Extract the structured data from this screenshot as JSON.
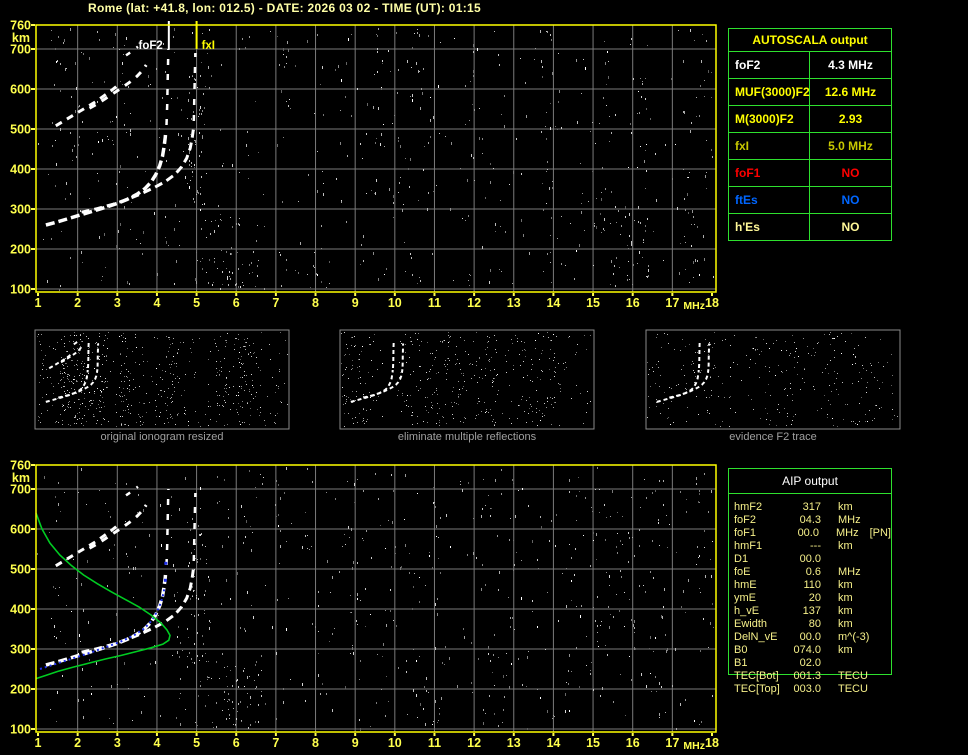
{
  "header": {
    "station": "Rome",
    "lat": "+41.8",
    "lon": "012.5",
    "date": "2026 03 02",
    "time_ut": "01:15",
    "full": "Rome (lat: +41.8, lon: 012.5) - DATE: 2026 03 02 - TIME (UT): 01:15"
  },
  "colors": {
    "title": "#ffffa6",
    "axis": "#ffff4d",
    "grid": "#7a7a7a",
    "plot_border": "#ffff00",
    "table_border": "#2ee02e",
    "aip_text": "#f6f08a",
    "trace": "#ffffff",
    "profile": "#00cc22",
    "restored": "#2233ee",
    "caption": "#a0a0a0"
  },
  "autoscala_table": {
    "header": "AUTOSCALA output",
    "rows": [
      {
        "param": "foF2",
        "value": "4.3 MHz",
        "color": "#ffffff"
      },
      {
        "param": "MUF(3000)F2",
        "value": "12.6 MHz",
        "color": "#ffff00"
      },
      {
        "param": "M(3000)F2",
        "value": "2.93",
        "color": "#ffff00"
      },
      {
        "param": "fxI",
        "value": "5.0 MHz",
        "color": "#c8c800"
      },
      {
        "param": "foF1",
        "value": "NO",
        "color": "#ff0000"
      },
      {
        "param": "ftEs",
        "value": "NO",
        "color": "#0066ff"
      },
      {
        "param": "h'Es",
        "value": "NO",
        "color": "#fff898"
      }
    ]
  },
  "aip_table": {
    "header": "AIP output",
    "rows": [
      {
        "param": "hmF2",
        "value": "317",
        "unit": "km",
        "note": ""
      },
      {
        "param": "foF2",
        "value": "04.3",
        "unit": "MHz",
        "note": ""
      },
      {
        "param": "foF1",
        "value": "00.0",
        "unit": "MHz",
        "note": "[PN]"
      },
      {
        "param": "hmF1",
        "value": "---",
        "unit": "km",
        "note": ""
      },
      {
        "param": "D1",
        "value": "00.0",
        "unit": "",
        "note": ""
      },
      {
        "param": "foE",
        "value": "0.6",
        "unit": "MHz",
        "note": ""
      },
      {
        "param": "hmE",
        "value": "110",
        "unit": "km",
        "note": ""
      },
      {
        "param": "ymE",
        "value": "20",
        "unit": "km",
        "note": ""
      },
      {
        "param": "h_vE",
        "value": "137",
        "unit": "km",
        "note": ""
      },
      {
        "param": "Ewidth",
        "value": "80",
        "unit": "km",
        "note": ""
      },
      {
        "param": "DelN_vE",
        "value": "00.0",
        "unit": "m^(-3)",
        "note": ""
      },
      {
        "param": "B0",
        "value": "074.0",
        "unit": "km",
        "note": ""
      },
      {
        "param": "B1",
        "value": "02.0",
        "unit": "",
        "note": ""
      },
      {
        "param": "TEC[Bot]",
        "value": "001.3",
        "unit": "TECU",
        "note": ""
      },
      {
        "param": "TEC[Top]",
        "value": "003.0",
        "unit": "TECU",
        "note": ""
      }
    ]
  },
  "thumbnails": [
    {
      "caption": "original ionogram resized"
    },
    {
      "caption": "eliminate multiple reflections"
    },
    {
      "caption": "evidence F2 trace"
    }
  ],
  "chart_data": {
    "type": "scatter",
    "title": "Rome ionogram 2026-03-02 01:15 UT, autoscaled by AUTOSCALA",
    "xlabel": "MHz",
    "ylabel": "km",
    "xlim": [
      1,
      18
    ],
    "ylim": [
      100,
      760
    ],
    "x_ticks": [
      1,
      2,
      3,
      4,
      5,
      6,
      7,
      8,
      9,
      10,
      11,
      12,
      13,
      14,
      15,
      16,
      17,
      18
    ],
    "y_ticks": [
      760,
      700,
      600,
      500,
      400,
      300,
      200,
      100
    ],
    "grid": true,
    "legend": "none",
    "echo_traces": [
      {
        "name": "F2 O-mode trace",
        "color": "#ffffff",
        "width": 3.5,
        "dash": "9 4",
        "multiple_reflection": false,
        "points": [
          [
            1.2,
            260
          ],
          [
            1.5,
            268
          ],
          [
            1.8,
            277
          ],
          [
            2.1,
            286
          ],
          [
            2.4,
            295
          ],
          [
            2.7,
            304
          ],
          [
            3.0,
            314
          ],
          [
            3.25,
            324
          ],
          [
            3.5,
            337
          ],
          [
            3.7,
            351
          ],
          [
            3.85,
            367
          ],
          [
            3.97,
            386
          ],
          [
            4.07,
            408
          ],
          [
            4.14,
            432
          ],
          [
            4.18,
            456
          ],
          [
            4.21,
            480
          ],
          [
            4.22,
            495
          ]
        ]
      },
      {
        "name": "F2 O-mode asymptote",
        "color": "#ffffff",
        "width": 2.5,
        "dash": "6 9",
        "multiple_reflection": false,
        "points": [
          [
            4.24,
            510
          ],
          [
            4.26,
            560
          ],
          [
            4.27,
            610
          ],
          [
            4.28,
            660
          ],
          [
            4.29,
            700
          ]
        ]
      },
      {
        "name": "F2 X-mode trace",
        "color": "#ffffff",
        "width": 3,
        "dash": "8 5",
        "multiple_reflection": false,
        "points": [
          [
            2.1,
            292
          ],
          [
            2.5,
            301
          ],
          [
            2.9,
            312
          ],
          [
            3.25,
            324
          ],
          [
            3.6,
            338
          ],
          [
            3.9,
            352
          ],
          [
            4.2,
            368
          ],
          [
            4.45,
            386
          ],
          [
            4.62,
            405
          ],
          [
            4.75,
            427
          ],
          [
            4.84,
            452
          ],
          [
            4.89,
            478
          ],
          [
            4.92,
            500
          ]
        ]
      },
      {
        "name": "F2 X-mode asymptote",
        "color": "#ffffff",
        "width": 2.5,
        "dash": "6 10",
        "multiple_reflection": false,
        "points": [
          [
            4.93,
            520
          ],
          [
            4.94,
            565
          ],
          [
            4.95,
            610
          ],
          [
            4.96,
            655
          ],
          [
            4.97,
            690
          ]
        ]
      },
      {
        "name": "second hop O",
        "color": "#ffffff",
        "width": 3,
        "dash": "7 6",
        "multiple_reflection": true,
        "points": [
          [
            1.45,
            508
          ],
          [
            1.65,
            520
          ],
          [
            1.85,
            532
          ],
          [
            2.05,
            544
          ],
          [
            2.25,
            556
          ],
          [
            2.45,
            568
          ],
          [
            2.65,
            582
          ],
          [
            2.85,
            596
          ],
          [
            3.0,
            608
          ]
        ]
      },
      {
        "name": "second hop X",
        "color": "#ffffff",
        "width": 3,
        "dash": "7 7",
        "multiple_reflection": true,
        "points": [
          [
            2.3,
            552
          ],
          [
            2.5,
            563
          ],
          [
            2.7,
            576
          ],
          [
            2.9,
            589
          ],
          [
            3.1,
            602
          ],
          [
            3.3,
            616
          ],
          [
            3.5,
            632
          ],
          [
            3.65,
            648
          ],
          [
            3.73,
            660
          ]
        ]
      },
      {
        "name": "second hop upper bits",
        "color": "#ffffff",
        "width": 2.5,
        "dash": "5 8",
        "multiple_reflection": true,
        "points": [
          [
            3.22,
            684
          ],
          [
            3.38,
            695
          ],
          [
            3.52,
            706
          ]
        ]
      }
    ],
    "plots": [
      {
        "name": "autoscaled ionogram",
        "markers": [
          {
            "name": "foF2 marker",
            "label": "foF2",
            "x": 4.3,
            "color": "#ffffff",
            "label_side": "left"
          },
          {
            "name": "fxI marker",
            "label": "fxI",
            "x": 5.0,
            "color": "#ffff00",
            "label_side": "right"
          }
        ],
        "extra_series": []
      },
      {
        "name": "profile ionogram",
        "markers": [],
        "extra_series": [
          {
            "name": "restored O trace",
            "color": "#2233ee",
            "width": 2,
            "dash": "2 3",
            "multiple_reflection": false,
            "points": [
              [
                1.05,
                250
              ],
              [
                1.3,
                258
              ],
              [
                1.55,
                266
              ],
              [
                1.8,
                274
              ],
              [
                2.05,
                282
              ],
              [
                2.3,
                290
              ],
              [
                2.55,
                299
              ],
              [
                2.8,
                308
              ],
              [
                3.05,
                317
              ],
              [
                3.25,
                326
              ],
              [
                3.45,
                336
              ],
              [
                3.65,
                349
              ],
              [
                3.8,
                363
              ],
              [
                3.92,
                379
              ],
              [
                4.02,
                397
              ],
              [
                4.1,
                416
              ],
              [
                4.15,
                434
              ],
              [
                4.19,
                452
              ]
            ]
          },
          {
            "name": "restored trace dots",
            "color": "#2233ee",
            "width": 3,
            "dash": "3 14",
            "multiple_reflection": false,
            "points": [
              [
                4.21,
                468
              ],
              [
                4.22,
                505
              ],
              [
                4.23,
                540
              ]
            ]
          },
          {
            "name": "electron density profile",
            "color": "#00cc22",
            "width": 1.6,
            "dash": "",
            "multiple_reflection": false,
            "points": [
              [
                0.95,
                640
              ],
              [
                1.1,
                600
              ],
              [
                1.3,
                565
              ],
              [
                1.55,
                535
              ],
              [
                1.85,
                508
              ],
              [
                2.15,
                485
              ],
              [
                2.5,
                463
              ],
              [
                2.85,
                443
              ],
              [
                3.2,
                424
              ],
              [
                3.55,
                405
              ],
              [
                3.85,
                385
              ],
              [
                4.1,
                365
              ],
              [
                4.25,
                348
              ],
              [
                4.33,
                334
              ],
              [
                4.3,
                322
              ],
              [
                4.15,
                312
              ],
              [
                3.85,
                303
              ],
              [
                3.5,
                294
              ],
              [
                3.1,
                284
              ],
              [
                2.7,
                275
              ],
              [
                2.3,
                265
              ],
              [
                1.9,
                255
              ],
              [
                1.5,
                244
              ],
              [
                1.2,
                234
              ],
              [
                0.95,
                226
              ]
            ]
          }
        ]
      }
    ]
  }
}
